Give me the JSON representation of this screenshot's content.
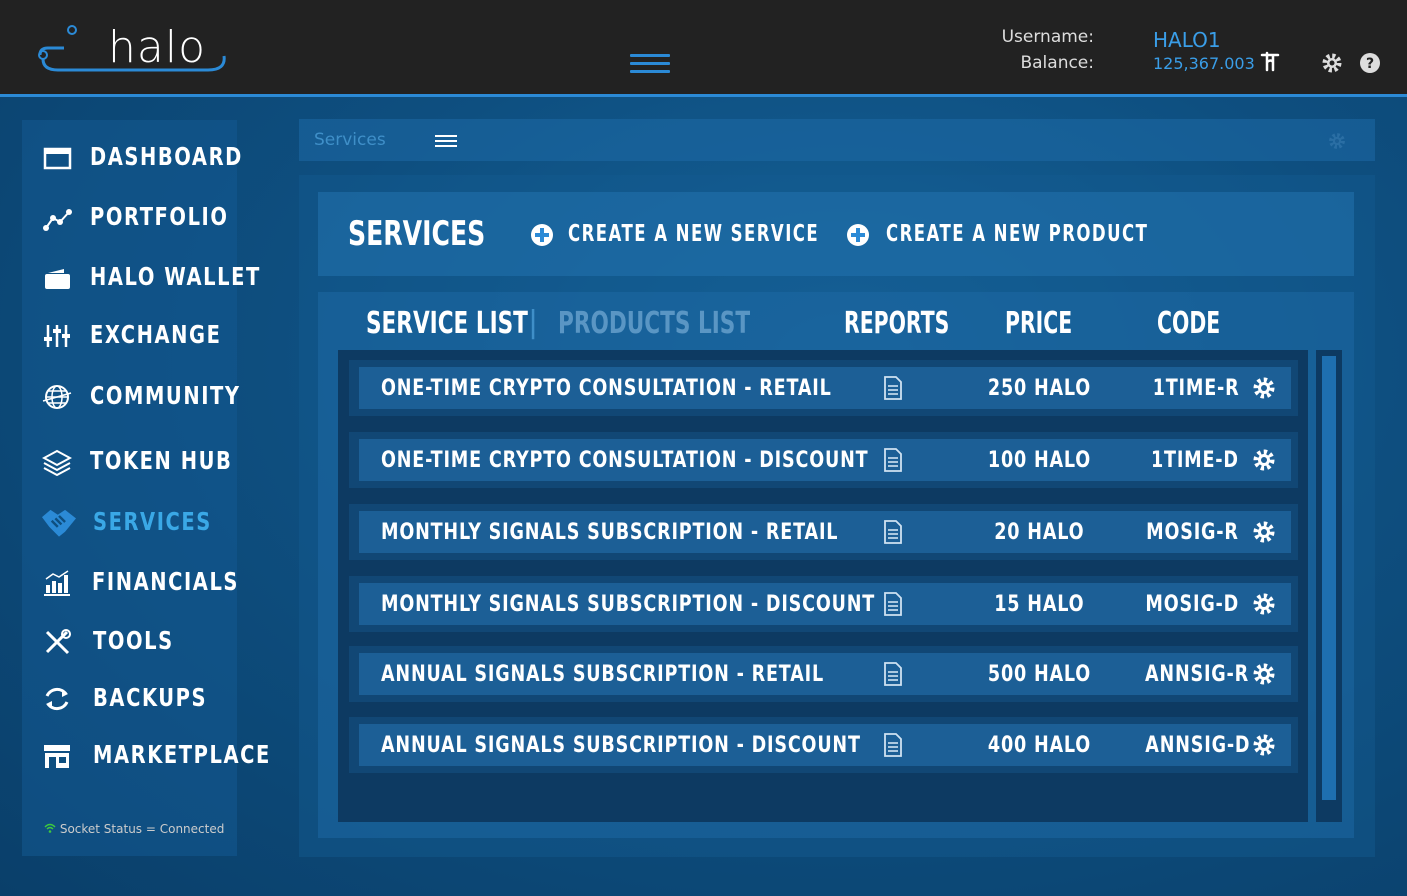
{
  "header": {
    "logo_text": "halo",
    "username_label": "Username:",
    "username": "HALO1",
    "balance_label": "Balance:",
    "balance": "125,367.003"
  },
  "sidebar": {
    "items": [
      {
        "label": "DASHBOARD",
        "icon": "browser-window-icon"
      },
      {
        "label": "PORTFOLIO",
        "icon": "line-graph-icon"
      },
      {
        "label": "HALO WALLET",
        "icon": "wallet-icon"
      },
      {
        "label": "EXCHANGE",
        "icon": "sliders-icon"
      },
      {
        "label": "COMMUNITY",
        "icon": "globe-icon"
      },
      {
        "label": "TOKEN HUB",
        "icon": "layers-icon"
      },
      {
        "label": "SERVICES",
        "icon": "handshake-icon"
      },
      {
        "label": "FINANCIALS",
        "icon": "bar-chart-icon"
      },
      {
        "label": "TOOLS",
        "icon": "tools-icon"
      },
      {
        "label": "BACKUPS",
        "icon": "refresh-icon"
      },
      {
        "label": "MARKETPLACE",
        "icon": "store-icon"
      }
    ],
    "active": "SERVICES",
    "socket_status": "Socket Status = Connected"
  },
  "panel": {
    "title": "Services"
  },
  "services": {
    "title": "SERVICES",
    "create_service": "CREATE A NEW SERVICE",
    "create_product": "CREATE A NEW PRODUCT"
  },
  "list": {
    "tab_service": "SERVICE LIST",
    "separator": "|",
    "tab_products": "PRODUCTS LIST",
    "col_reports": "REPORTS",
    "col_price": "PRICE",
    "col_code": "CODE",
    "rows": [
      {
        "name": "ONE-TIME CRYPTO CONSULTATION - RETAIL",
        "price": "250 HALO",
        "code": "1TIME-R"
      },
      {
        "name": "ONE-TIME CRYPTO CONSULTATION - DISCOUNT",
        "price": "100 HALO",
        "code": "1TIME-D"
      },
      {
        "name": "MONTHLY SIGNALS SUBSCRIPTION - RETAIL",
        "price": "20 HALO",
        "code": "MOSIG-R"
      },
      {
        "name": "MONTHLY SIGNALS SUBSCRIPTION - DISCOUNT",
        "price": "15 HALO",
        "code": "MOSIG-D"
      },
      {
        "name": "ANNUAL SIGNALS SUBSCRIPTION - RETAIL",
        "price": "500 HALO",
        "code": "ANNSIG-R"
      },
      {
        "name": "ANNUAL SIGNALS SUBSCRIPTION - DISCOUNT",
        "price": "400 HALO",
        "code": "ANNSIG-D"
      }
    ]
  },
  "colors": {
    "accent": "#2b8ad6",
    "active_nav": "#3aa8e6",
    "topbar": "#222222"
  }
}
